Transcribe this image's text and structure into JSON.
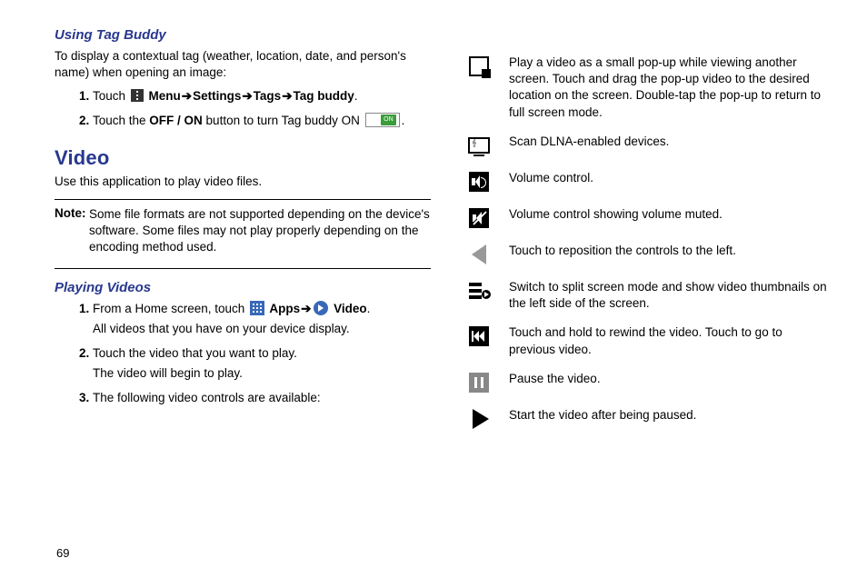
{
  "left": {
    "tag_buddy": {
      "heading": "Using Tag Buddy",
      "intro": "To display a contextual tag (weather, location, date, and person's name) when opening an image:",
      "step1_touch": "Touch ",
      "step1_menu": " Menu",
      "step1_arrow": " ➔ ",
      "step1_settings": "Settings",
      "step1_tags": "Tags",
      "step1_tagbuddy": "Tag buddy",
      "step1_period": ".",
      "step2_a": "Touch the ",
      "step2_offon": "OFF / ON",
      "step2_b": " button to turn Tag buddy ON ",
      "step2_c": "."
    },
    "video": {
      "heading": "Video",
      "intro": "Use this application to play video files.",
      "note_label": "Note: ",
      "note_body": "Some file formats are not supported depending on the device's software. Some files may not play properly depending on the encoding method used."
    },
    "playing": {
      "heading": "Playing Videos",
      "s1_a": "From a Home screen, touch ",
      "s1_apps": " Apps",
      "s1_arrow": " ➔ ",
      "s1_video": " Video",
      "s1_period": ".",
      "s1_sub": "All videos that you have on your device display.",
      "s2": "Touch the video that you want to play.",
      "s2_sub": "The video will begin to play.",
      "s3": "The following video controls are available:"
    }
  },
  "controls": {
    "popup": "Play a video as a small pop-up while viewing another screen. Touch and drag the pop-up video to the desired location on the screen. Double-tap the pop-up to return to full screen mode.",
    "dlna": "Scan DLNA-enabled devices.",
    "volume": "Volume control.",
    "volmute": "Volume control showing volume muted.",
    "reposition": "Touch to reposition the controls to the left.",
    "split": "Switch to split screen mode and show video thumbnails on the left side of the screen.",
    "rewind": "Touch and hold to rewind the video. Touch to go to previous video.",
    "pause": "Pause the video.",
    "play": "Start the video after being paused."
  },
  "page_number": "69"
}
